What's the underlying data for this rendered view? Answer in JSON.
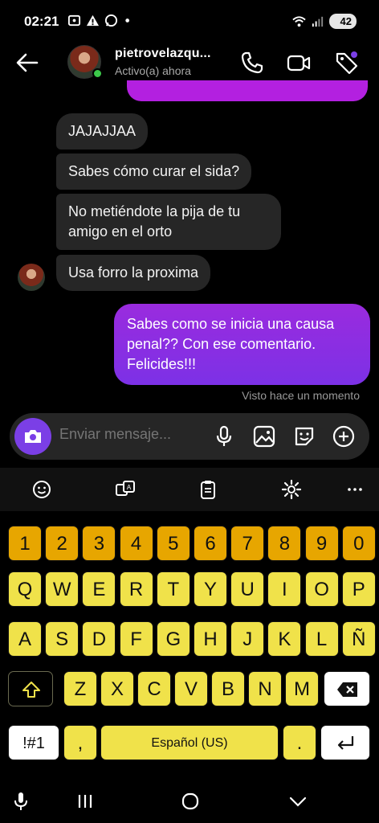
{
  "status_bar": {
    "time": "02:21",
    "battery": "42"
  },
  "header": {
    "username": "pietrovelazqu...",
    "activity": "Activo(a) ahora"
  },
  "messages": {
    "incoming": [
      "JAJAJJAA",
      "Sabes cómo curar el sida?",
      "No metiéndote la pija de tu amigo en el orto",
      "Usa forro la proxima"
    ],
    "outgoing": "Sabes como se inicia una causa penal?? Con ese comentario. Felicides!!!",
    "seen_status": "Visto hace un momento"
  },
  "composer": {
    "placeholder": "Enviar mensaje..."
  },
  "keyboard": {
    "numbers": [
      "1",
      "2",
      "3",
      "4",
      "5",
      "6",
      "7",
      "8",
      "9",
      "0"
    ],
    "row1": [
      "Q",
      "W",
      "E",
      "R",
      "T",
      "Y",
      "U",
      "I",
      "O",
      "P"
    ],
    "row2": [
      "A",
      "S",
      "D",
      "F",
      "G",
      "H",
      "J",
      "K",
      "L",
      "Ñ"
    ],
    "row3": [
      "Z",
      "X",
      "C",
      "V",
      "B",
      "N",
      "M"
    ],
    "symbols_key": "!#1",
    "comma": ",",
    "space": "Español (US)",
    "period": "."
  },
  "colors": {
    "accent": "#7b3fe6",
    "outgoing_bubble": "#8a2be2",
    "key_yellow": "#f0e24a",
    "key_orange": "#e7a600"
  }
}
